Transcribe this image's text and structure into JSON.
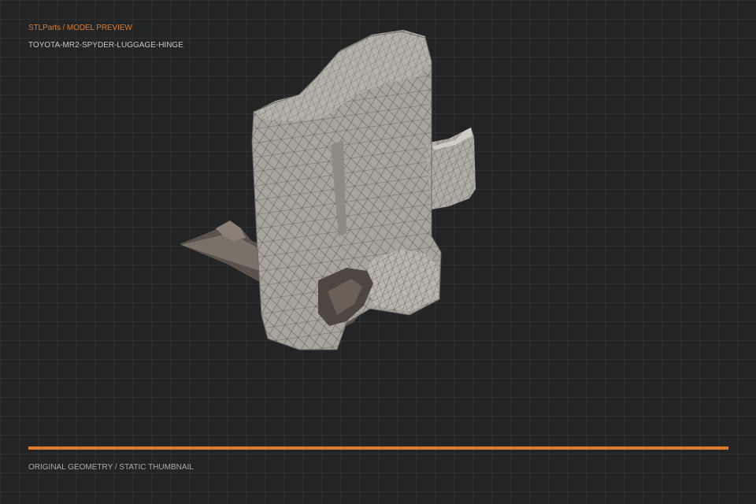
{
  "header": {
    "breadcrumb": "STLParts / MODEL PREVIEW",
    "model_name": "TOYOTA-MR2-SPYDER-LUGGAGE-HINGE"
  },
  "footer": {
    "caption": "ORIGINAL GEOMETRY / STATIC THUMBNAIL"
  },
  "colors": {
    "background": "#232425",
    "grid": "#2c2e30",
    "accent": "#e07a2c",
    "mesh_fill": "#a8a59e",
    "mesh_shadow": "#5b524b",
    "wire": "#6a665f"
  }
}
